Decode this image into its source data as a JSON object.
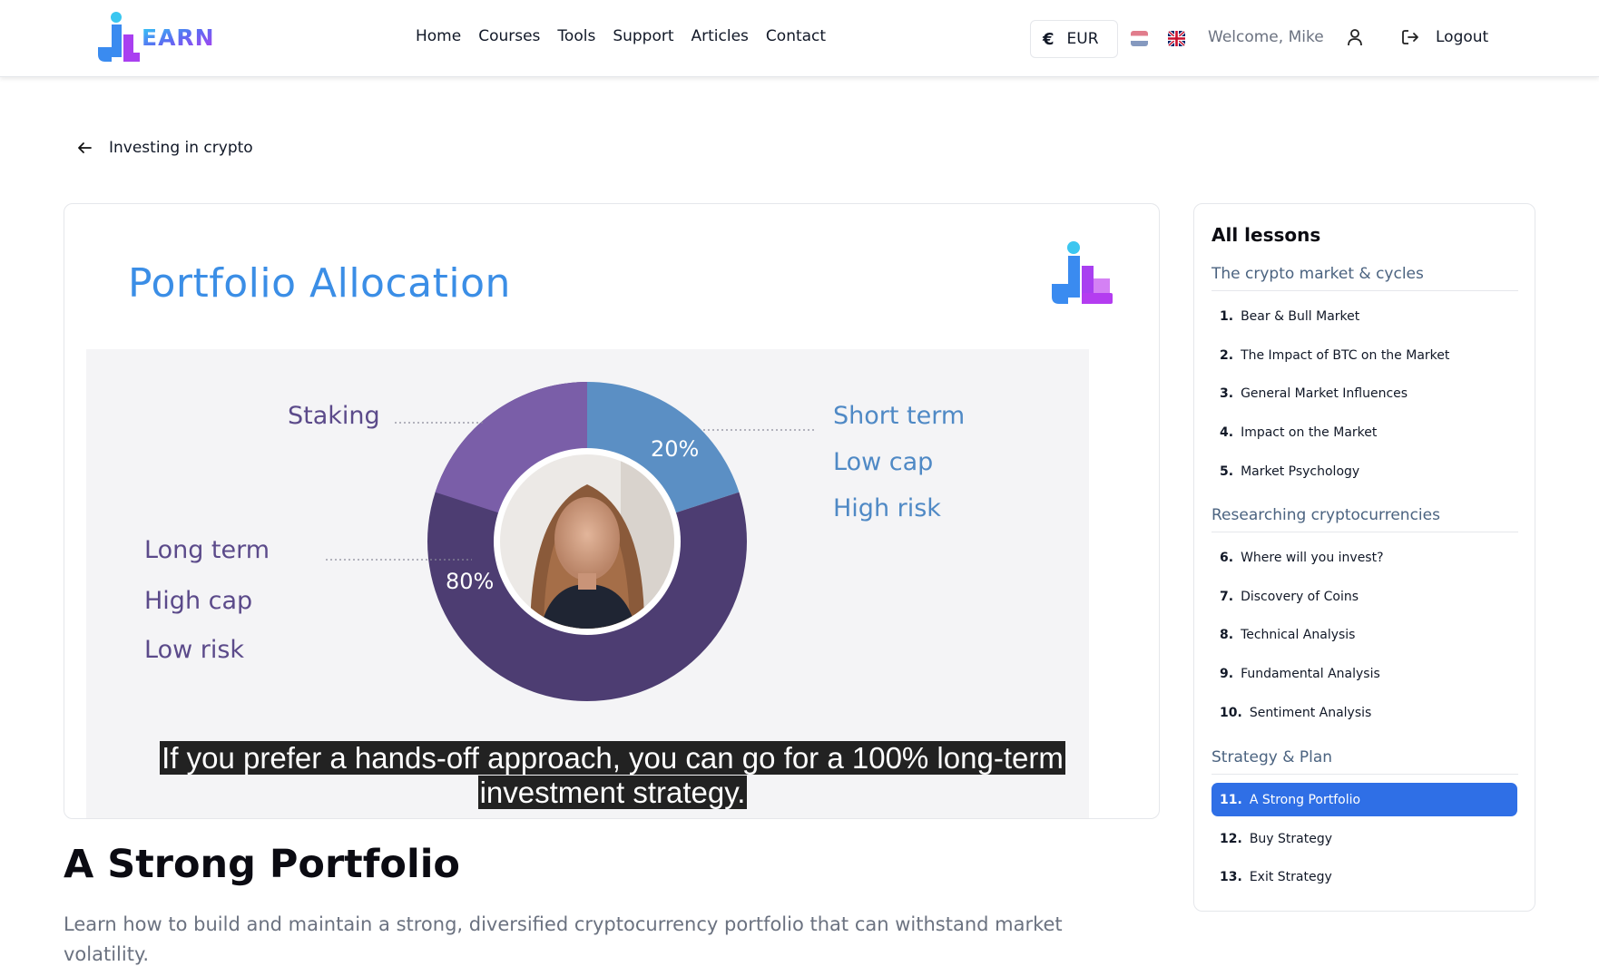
{
  "header": {
    "nav": [
      "Home",
      "Courses",
      "Tools",
      "Support",
      "Articles",
      "Contact"
    ],
    "currency_symbol": "€",
    "currency": "EUR",
    "welcome": "Welcome, Mike",
    "logout": "Logout",
    "icons": [
      "logo",
      "euro-icon",
      "flag-nl-icon",
      "flag-uk-icon",
      "user-icon",
      "logout-icon"
    ]
  },
  "breadcrumb": {
    "label": "Investing in crypto",
    "icon": "arrow-left-icon"
  },
  "video": {
    "slide_title": "Portfolio Allocation",
    "labels": {
      "staking": "Staking",
      "right": [
        "Short term",
        "Low cap",
        "High risk"
      ],
      "left": [
        "Long term",
        "High cap",
        "Low risk"
      ]
    },
    "chart_data": {
      "type": "pie",
      "slices": [
        {
          "label": "Short term / Low cap / High risk",
          "value": 20,
          "display": "20%",
          "color": "#5b8fc4"
        },
        {
          "label": "Long term / High cap / Low risk",
          "value": 80,
          "display": "80%",
          "color": "#4d3d72",
          "inner_segment": {
            "label": "Staking",
            "share_of_total": 20,
            "color": "#7a5ea8"
          }
        }
      ]
    },
    "caption_line1": "If you prefer a hands-off approach, you can go for a 100% long-term",
    "caption_line2": "investment strategy."
  },
  "lesson": {
    "title": "A Strong Portfolio",
    "description": "Learn how to build and maintain a strong, diversified cryptocurrency portfolio that can withstand market volatility."
  },
  "sidebar": {
    "title": "All lessons",
    "sections": [
      {
        "title": "The crypto market & cycles",
        "lessons": [
          {
            "num": "1.",
            "label": "Bear & Bull Market"
          },
          {
            "num": "2.",
            "label": "The Impact of BTC on the Market"
          },
          {
            "num": "3.",
            "label": "General Market Influences"
          },
          {
            "num": "4.",
            "label": "Impact on the Market"
          },
          {
            "num": "5.",
            "label": "Market Psychology"
          }
        ]
      },
      {
        "title": "Researching cryptocurrencies",
        "lessons": [
          {
            "num": "6.",
            "label": "Where will you invest?"
          },
          {
            "num": "7.",
            "label": "Discovery of Coins"
          },
          {
            "num": "8.",
            "label": "Technical Analysis"
          },
          {
            "num": "9.",
            "label": "Fundamental Analysis"
          },
          {
            "num": "10.",
            "label": "Sentiment Analysis"
          }
        ]
      },
      {
        "title": "Strategy & Plan",
        "lessons": [
          {
            "num": "11.",
            "label": "A Strong Portfolio",
            "active": true
          },
          {
            "num": "12.",
            "label": "Buy Strategy"
          },
          {
            "num": "13.",
            "label": "Exit Strategy"
          }
        ]
      }
    ]
  },
  "colors": {
    "accent": "#2f6fe6",
    "slide_title": "#3b8ee6",
    "purple": "#4d3d72",
    "blue": "#5b8fc4"
  }
}
